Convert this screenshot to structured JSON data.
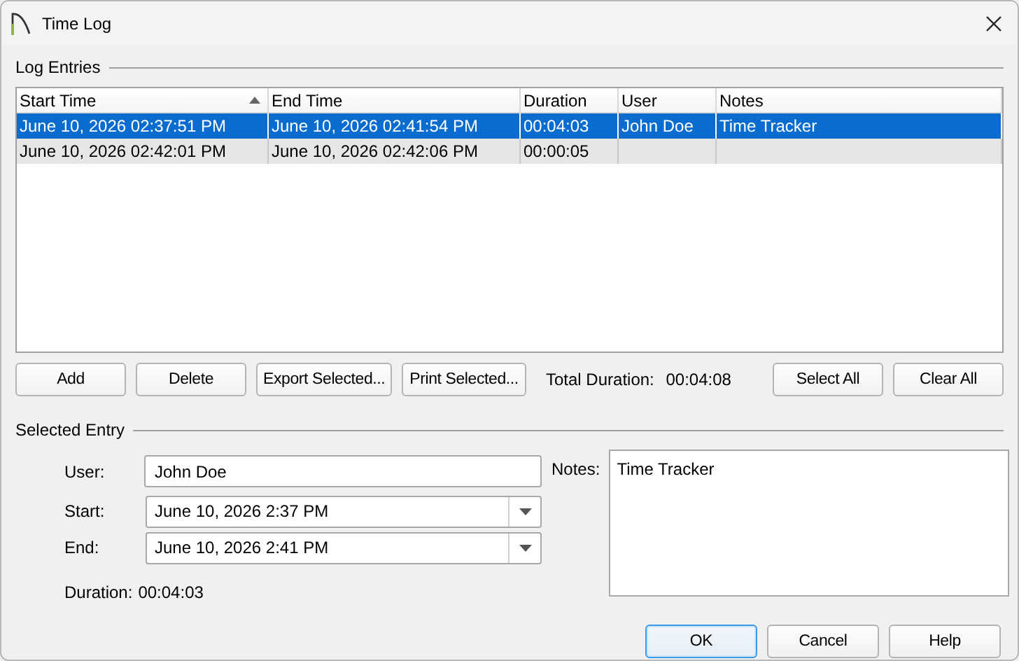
{
  "window": {
    "title": "Time Log"
  },
  "log_entries": {
    "label": "Log Entries",
    "columns": [
      {
        "label": "Start Time",
        "sorted": true
      },
      {
        "label": "End Time",
        "sorted": false
      },
      {
        "label": "Duration",
        "sorted": false
      },
      {
        "label": "User",
        "sorted": false
      },
      {
        "label": "Notes",
        "sorted": false
      }
    ],
    "rows": [
      {
        "selected": true,
        "cells": [
          "June 10, 2026 02:37:51 PM",
          "June 10, 2026 02:41:54 PM",
          "00:04:03",
          "John Doe",
          "Time Tracker"
        ]
      },
      {
        "selected": false,
        "cells": [
          "June 10, 2026 02:42:01 PM",
          "June 10, 2026 02:42:06 PM",
          "00:00:05",
          "",
          ""
        ]
      }
    ]
  },
  "actions": [
    "Add",
    "Delete",
    "Export Selected...",
    "Print Selected..."
  ],
  "total_duration": {
    "label": "Total Duration:",
    "value": "00:04:08"
  },
  "selection_actions": [
    "Select All",
    "Clear All"
  ],
  "selected_entry": {
    "label": "Selected Entry",
    "user": {
      "label": "User:",
      "value": "John Doe"
    },
    "start": {
      "label": "Start:",
      "value": "June 10, 2026 2:37 PM"
    },
    "end": {
      "label": "End:",
      "value": "June 10, 2026 2:41 PM"
    },
    "duration": {
      "label": "Duration:",
      "value": "00:04:03"
    },
    "notes": {
      "label": "Notes:",
      "value": "Time Tracker"
    }
  },
  "footer_buttons": [
    {
      "label": "OK",
      "default": true
    },
    {
      "label": "Cancel",
      "default": false
    },
    {
      "label": "Help",
      "default": false
    }
  ]
}
